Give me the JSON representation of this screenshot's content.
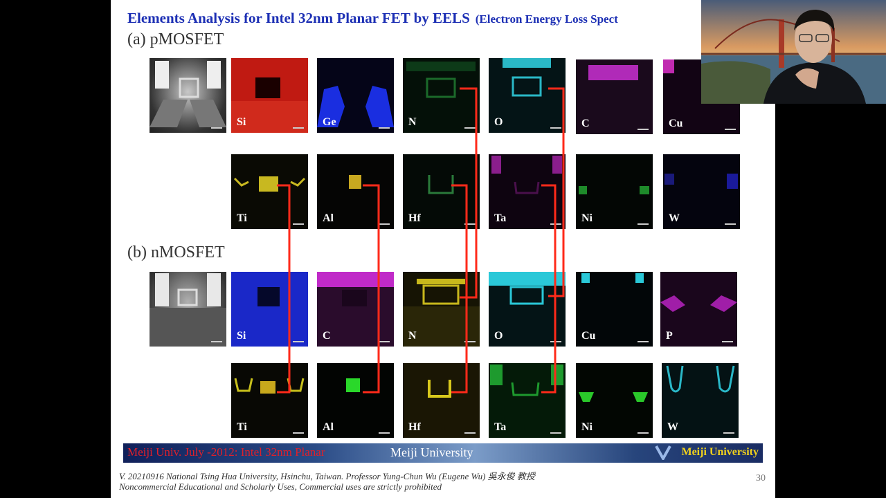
{
  "slide": {
    "title": "Elements Analysis for Intel 32nm Planar FET by EELS",
    "title_suffix": "(Electron Energy Loss Spect",
    "section_a": "(a) pMOSFET",
    "section_b": "(b) nMOSFET",
    "pmos_row1": [
      "",
      "Si",
      "Ge",
      "N",
      "O",
      "C",
      "Cu"
    ],
    "pmos_row2": [
      "Ti",
      "Al",
      "Hf",
      "Ta",
      "Ni",
      "W"
    ],
    "nmos_row1": [
      "",
      "Si",
      "C",
      "N",
      "O",
      "Cu",
      "P"
    ],
    "nmos_row2": [
      "Ti",
      "Al",
      "Hf",
      "Ta",
      "Ni",
      "W"
    ],
    "banner_left": "Meiji Univ. July -2012: Intel 32nm Planar",
    "banner_center": "Meiji University",
    "banner_right": "Meiji University",
    "footer_line1": "V. 20210916 National Tsing Hua University, Hsinchu, Taiwan. Professor Yung-Chun Wu (Eugene Wu) 吳永俊 教授",
    "footer_line2": "Noncommercial Educational and Scholarly Uses, Commercial uses are strictly prohibited",
    "page_number": "30"
  },
  "colors": {
    "title": "#1c2fb4",
    "leader_lines": "#ff2a1a",
    "banner_left_text": "#e0202a",
    "banner_right_text": "#f2d21c"
  },
  "webcam": {
    "description_icon": "presenter-video-icon"
  }
}
